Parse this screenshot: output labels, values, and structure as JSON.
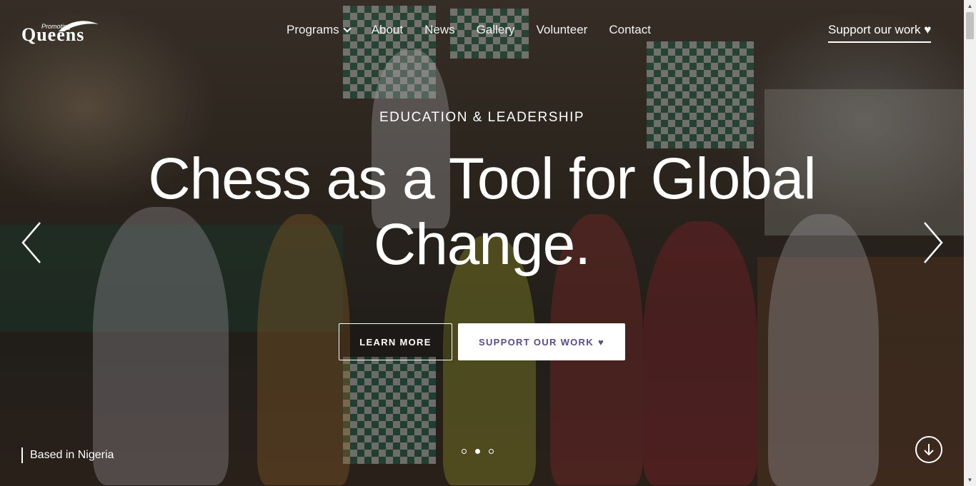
{
  "brand": {
    "logo_small": "Promoting",
    "logo_big": "Queens"
  },
  "nav": {
    "items": [
      {
        "label": "Programs",
        "has_dropdown": true
      },
      {
        "label": "About"
      },
      {
        "label": "News"
      },
      {
        "label": "Gallery"
      },
      {
        "label": "Volunteer"
      },
      {
        "label": "Contact"
      }
    ],
    "support_label": "Support our work",
    "support_icon": "heart-icon"
  },
  "hero": {
    "eyebrow": "EDUCATION & LEADERSHIP",
    "headline": "Chess as a Tool for Global Change.",
    "learn_more": "LEARN MORE",
    "support": "SUPPORT OUR WORK",
    "support_icon": "heart-icon",
    "location": "Based in Nigeria",
    "slides": {
      "count": 3,
      "active": 2
    }
  },
  "colors": {
    "accent": "#5a4b8a",
    "text": "#ffffff"
  }
}
